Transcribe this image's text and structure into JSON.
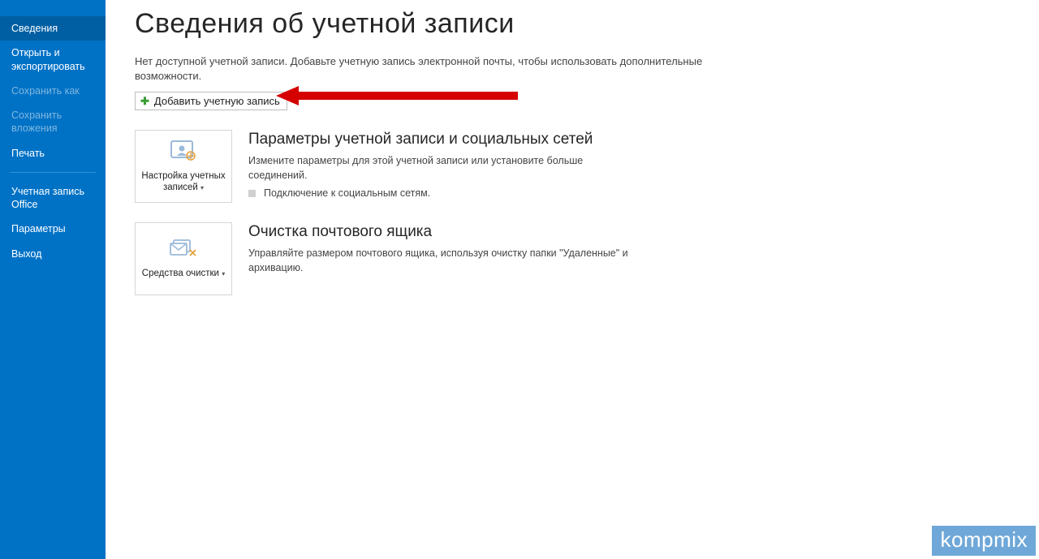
{
  "sidebar": {
    "items": [
      {
        "label": "Сведения",
        "state": "active"
      },
      {
        "label": "Открыть и экспортировать",
        "state": "normal"
      },
      {
        "label": "Сохранить как",
        "state": "disabled"
      },
      {
        "label": "Сохранить вложения",
        "state": "disabled"
      },
      {
        "label": "Печать",
        "state": "normal"
      },
      {
        "label": "Учетная запись Office",
        "state": "normal"
      },
      {
        "label": "Параметры",
        "state": "normal"
      },
      {
        "label": "Выход",
        "state": "normal"
      }
    ]
  },
  "main": {
    "title": "Сведения об учетной записи",
    "intro": "Нет доступной учетной записи. Добавьте учетную запись электронной почты, чтобы использовать дополнительные возможности.",
    "add_button": "Добавить учетную запись",
    "sections": [
      {
        "tile_label": "Настройка учетных записей",
        "title": "Параметры учетной записи и социальных сетей",
        "desc": "Измените параметры для этой учетной записи или установите больше соединений.",
        "bullet": "Подключение к социальным сетям."
      },
      {
        "tile_label": "Средства очистки",
        "title": "Очистка почтового ящика",
        "desc": "Управляйте размером почтового ящика, используя очистку папки \"Удаленные\" и архивацию."
      }
    ]
  },
  "watermark": "kompmix"
}
